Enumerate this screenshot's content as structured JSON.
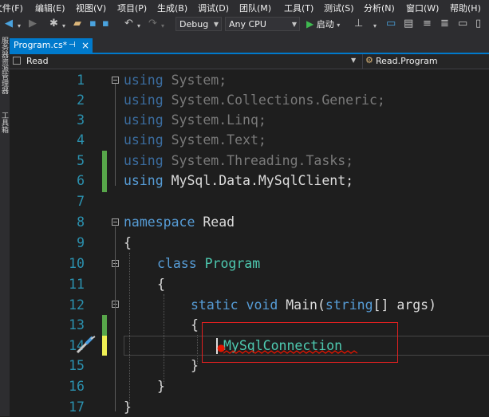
{
  "menu": [
    "文件(F)",
    "编辑(E)",
    "视图(V)",
    "项目(P)",
    "生成(B)",
    "调试(D)",
    "团队(M)",
    "工具(T)",
    "测试(S)",
    "分析(N)",
    "窗口(W)",
    "帮助(H)"
  ],
  "toolbar": {
    "configuration": "Debug",
    "platform": "Any CPU",
    "start_label": "启动"
  },
  "side_strip": {
    "items": [
      "服务器资源管理器",
      "工具箱"
    ]
  },
  "tab": {
    "title": "Program.cs*",
    "pin_glyph": "⊣",
    "close_glyph": "×"
  },
  "navbar": {
    "project": "Read",
    "scope": "Read.Program"
  },
  "editor": {
    "line_numbers": [
      "1",
      "2",
      "3",
      "4",
      "5",
      "6",
      "7",
      "8",
      "9",
      "10",
      "11",
      "12",
      "13",
      "14",
      "15",
      "16",
      "17"
    ],
    "lines": {
      "l1": {
        "kw": "using",
        "rest": " System;"
      },
      "l2": {
        "kw": "using",
        "rest": " System.Collections.Generic;"
      },
      "l3": {
        "kw": "using",
        "rest": " System.Linq;"
      },
      "l4": {
        "kw": "using",
        "rest": " System.Text;"
      },
      "l5": {
        "kw": "using",
        "rest": " System.Threading.Tasks;"
      },
      "l6": {
        "kw": "using",
        "rest": " MySql.Data.MySqlClient;"
      },
      "l8": {
        "kw": "namespace",
        "rest": " Read"
      },
      "l9": {
        "text": "{"
      },
      "l10": {
        "kw": "class",
        "type": "Program"
      },
      "l11": {
        "text": "{"
      },
      "l12": {
        "kw1": "static",
        "kw2": "void",
        "name": "Main",
        "kw3": "string",
        "rest": "[] args)"
      },
      "l13": {
        "text": "{"
      },
      "l14": {
        "text": "MySqlConnection"
      },
      "l15": {
        "text": "}"
      },
      "l16": {
        "text": "}"
      },
      "l17": {
        "text": "}"
      }
    },
    "colors": {
      "keyword": "#569cd6",
      "type": "#4ec9b0",
      "line_number": "#2b91af",
      "change_marker": "#57a64a",
      "unsaved_marker": "#efef54",
      "highlight_box": "#e02020",
      "error_squiggle": "#e51400"
    }
  }
}
